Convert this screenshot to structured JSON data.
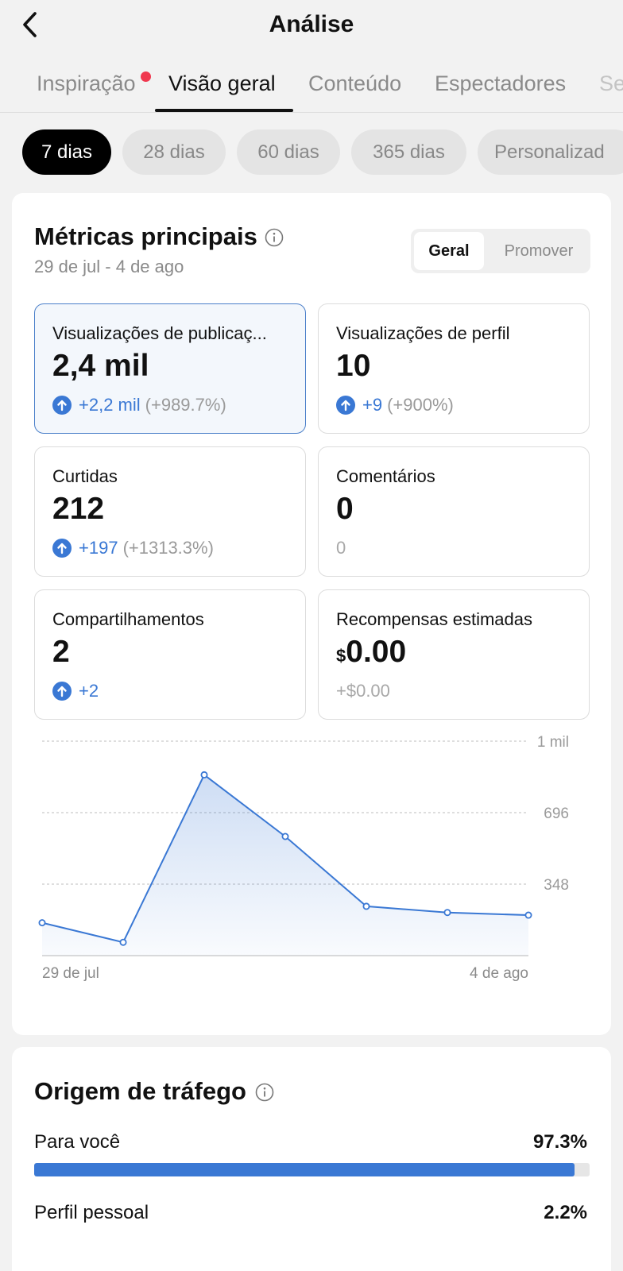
{
  "header": {
    "title": "Análise"
  },
  "tabs": [
    {
      "label": "Inspiração",
      "active": false,
      "dot": true
    },
    {
      "label": "Visão geral",
      "active": true
    },
    {
      "label": "Conteúdo",
      "active": false
    },
    {
      "label": "Espectadores",
      "active": false
    },
    {
      "label": "Se",
      "active": false
    }
  ],
  "periods": [
    {
      "label": "7 dias",
      "active": true
    },
    {
      "label": "28 dias",
      "active": false
    },
    {
      "label": "60 dias",
      "active": false
    },
    {
      "label": "365 dias",
      "active": false
    },
    {
      "label": "Personalizad",
      "active": false
    }
  ],
  "metrics_section": {
    "title": "Métricas principais",
    "date_range": "29 de jul - 4 de ago",
    "toggle": [
      {
        "label": "Geral",
        "active": true
      },
      {
        "label": "Promover",
        "active": false
      }
    ],
    "cards": [
      {
        "label": "Visualizações de publicaç...",
        "value": "2,4 mil",
        "delta": "+2,2 mil",
        "percent": "(+989.7%)",
        "trend": "up",
        "selected": true
      },
      {
        "label": "Visualizações de perfil",
        "value": "10",
        "delta": "+9",
        "percent": "(+900%)",
        "trend": "up",
        "selected": false
      },
      {
        "label": "Curtidas",
        "value": "212",
        "delta": "+197",
        "percent": "(+1313.3%)",
        "trend": "up",
        "selected": false
      },
      {
        "label": "Comentários",
        "value": "0",
        "delta": "0",
        "percent": "",
        "trend": "none",
        "selected": false
      },
      {
        "label": "Compartilhamentos",
        "value": "2",
        "delta": "+2",
        "percent": "",
        "trend": "up",
        "selected": false
      },
      {
        "label": "Recompensas estimadas",
        "currency": "$",
        "value": "0.00",
        "delta": "+$0.00",
        "percent": "",
        "trend": "none",
        "selected": false
      }
    ]
  },
  "chart_data": {
    "type": "area",
    "x": [
      "29 de jul",
      "30 de jul",
      "31 de jul",
      "1 de ago",
      "2 de ago",
      "3 de ago",
      "4 de ago"
    ],
    "values": [
      160,
      65,
      880,
      580,
      240,
      210,
      197
    ],
    "ylim": [
      0,
      1044
    ],
    "y_ticks": [
      {
        "value": 348,
        "label": "348"
      },
      {
        "value": 696,
        "label": "696"
      },
      {
        "value": 1044,
        "label": "1 mil"
      }
    ],
    "x_tick_labels": [
      "29 de jul",
      "4 de ago"
    ],
    "grid": true,
    "color": "#3a78d4"
  },
  "traffic": {
    "title": "Origem de tráfego",
    "rows": [
      {
        "label": "Para você",
        "value": "97.3%",
        "fraction": 0.973
      },
      {
        "label": "Perfil pessoal",
        "value": "2.2%",
        "fraction": 0.022
      }
    ]
  },
  "colors": {
    "accent": "#3a78d4",
    "notification_dot": "#f0384f",
    "active_chip": "#000000"
  }
}
